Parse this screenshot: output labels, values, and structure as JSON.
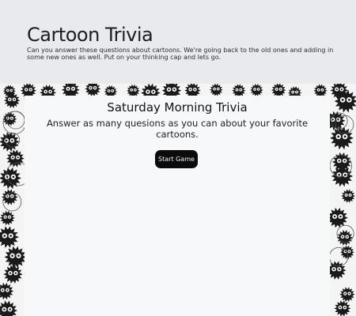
{
  "header": {
    "title": "Cartoon Trivia",
    "description": "Can you answer these questions about cartoons. We're going back to the old ones and adding in some new ones as well. Put on your thinking cap and lets go."
  },
  "card": {
    "title": "Saturday Morning Trivia",
    "subtitle": "Answer as many quesions as you can about your favorite cartoons.",
    "start_button": "Start Game"
  },
  "background": {
    "pattern": "soot-sprite doodles",
    "ink_color": "#1a1a1a"
  }
}
